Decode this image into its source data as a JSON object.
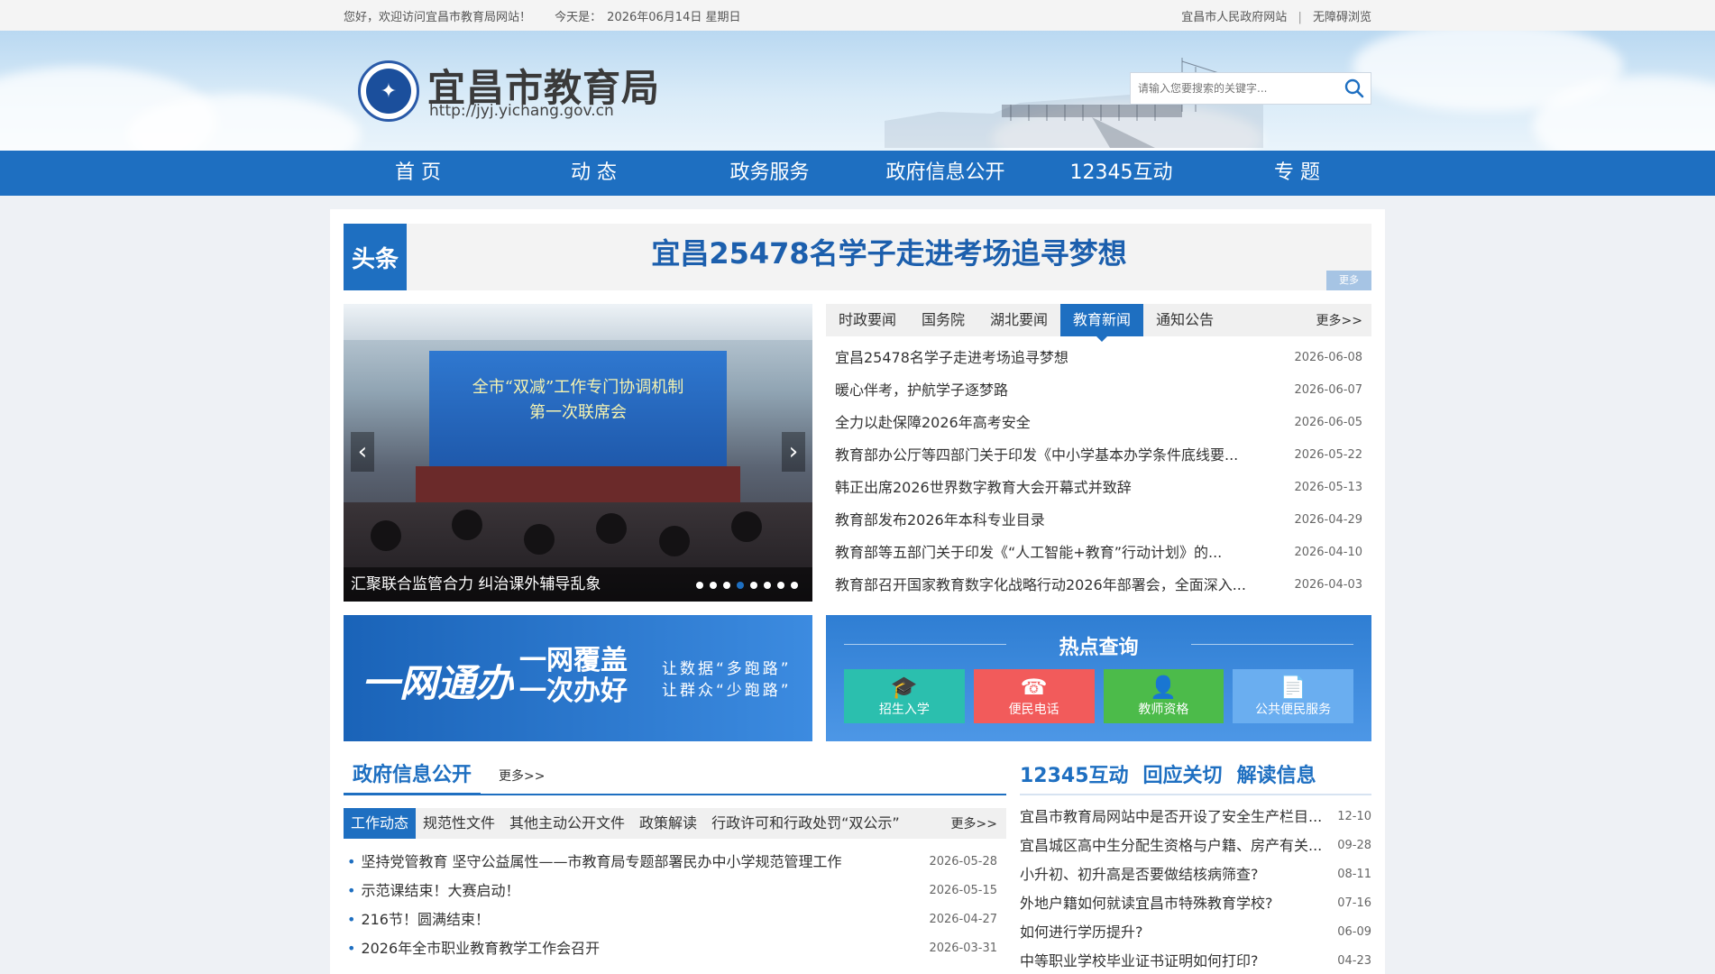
{
  "topbar": {
    "welcome": "您好，欢迎访问宜昌市教育局网站！",
    "today_label": "今天是：",
    "today_value": "2026年06月14日 星期日",
    "link_gov": "宜昌市人民政府网站",
    "separator": "|",
    "link_access": "无障碍浏览"
  },
  "header": {
    "site_name": "宜昌市教育局",
    "site_url": "http://jyj.yichang.gov.cn",
    "search_placeholder": "请输入您要搜索的关键字..."
  },
  "nav": [
    "首 页",
    "动 态",
    "政务服务",
    "政府信息公开",
    "12345互动",
    "专 题"
  ],
  "headline": {
    "tag": "头条",
    "title": "宜昌25478名学子走进考场追寻梦想",
    "more": "更多"
  },
  "slider": {
    "screen_line1": "全市“双减”工作专门协调机制",
    "screen_line2": "第一次联席会",
    "caption": "汇聚联合监管合力 纠治课外辅导乱象",
    "dot_count": 8,
    "active_dot": 3,
    "prev_arrow": "‹",
    "next_arrow": "›"
  },
  "news": {
    "tabs": [
      "时政要闻",
      "国务院",
      "湖北要闻",
      "教育新闻",
      "通知公告"
    ],
    "active_tab": 3,
    "more": "更多>>",
    "items": [
      {
        "title": "宜昌25478名学子走进考场追寻梦想",
        "date": "2026-06-08"
      },
      {
        "title": "暖心伴考，护航学子逐梦路",
        "date": "2026-06-07"
      },
      {
        "title": "全力以赴保障2026年高考安全",
        "date": "2026-06-05"
      },
      {
        "title": "教育部办公厅等四部门关于印发《中小学基本办学条件底线要...",
        "date": "2026-05-22"
      },
      {
        "title": "韩正出席2026世界数字教育大会开幕式并致辞",
        "date": "2026-05-13"
      },
      {
        "title": "教育部发布2026年本科专业目录",
        "date": "2026-04-29"
      },
      {
        "title": "教育部等五部门关于印发《“人工智能+教育”行动计划》的...",
        "date": "2026-04-10"
      },
      {
        "title": "教育部召开国家教育数字化战略行动2026年部署会，全面深入...",
        "date": "2026-04-03"
      }
    ]
  },
  "promo": {
    "a": "一网通办",
    "b1": "一网覆盖",
    "b2": "一次办好",
    "c1": "让数据“多跑路”",
    "c2": "让群众“少跑路”"
  },
  "hot": {
    "title": "热点查询",
    "buttons": [
      {
        "label": "招生入学",
        "icon": "graduation-cap-icon",
        "color": "#2bbfae"
      },
      {
        "label": "便民电话",
        "icon": "phone-icon",
        "color": "#f25b5b"
      },
      {
        "label": "教师资格",
        "icon": "teacher-icon",
        "color": "#4cbb4a"
      },
      {
        "label": "公共便民服务",
        "icon": "document-icon",
        "color": "#6aaef0"
      }
    ]
  },
  "gov": {
    "title": "政府信息公开",
    "more": "更多>>",
    "tabs": [
      "工作动态",
      "规范性文件",
      "其他主动公开文件",
      "政策解读",
      "行政许可和行政处罚“双公示”"
    ],
    "active_tab": 0,
    "tab_more": "更多>>",
    "items": [
      {
        "title": "坚持党管教育 坚守公益属性——市教育局专题部署民办中小学规范管理工作",
        "date": "2026-05-28"
      },
      {
        "title": "示范课结束！大赛启动！",
        "date": "2026-05-15"
      },
      {
        "title": "216节！圆满结束！",
        "date": "2026-04-27"
      },
      {
        "title": "2026年全市职业教育教学工作会召开",
        "date": "2026-03-31"
      }
    ]
  },
  "inter": {
    "tabs": [
      "12345互动",
      "回应关切",
      "解读信息"
    ],
    "items": [
      {
        "title": "宜昌市教育局网站中是否开设了安全生产栏目...",
        "date": "12-10"
      },
      {
        "title": "宜昌城区高中生分配生资格与户籍、房产有关...",
        "date": "09-28"
      },
      {
        "title": "小升初、初升高是否要做结核病筛查?",
        "date": "08-11"
      },
      {
        "title": "外地户籍如何就读宜昌市特殊教育学校?",
        "date": "07-16"
      },
      {
        "title": "如何进行学历提升?",
        "date": "06-09"
      },
      {
        "title": "中等职业学校毕业证书证明如何打印?",
        "date": "04-23"
      }
    ]
  }
}
